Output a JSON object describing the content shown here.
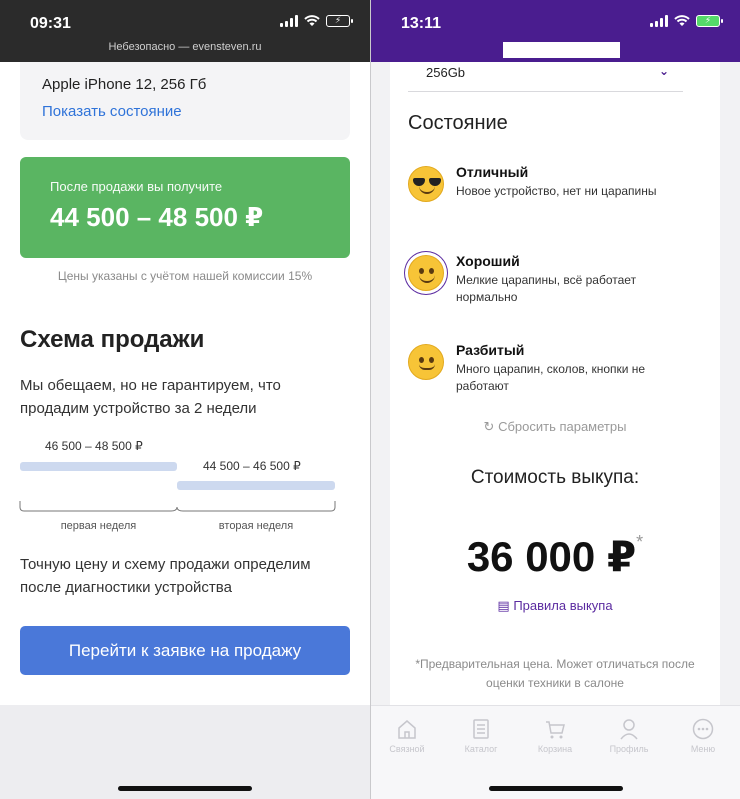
{
  "left": {
    "status": {
      "time": "09:31",
      "url": "Небезопасно — evensteven.ru"
    },
    "device": {
      "name": "Apple iPhone 12, 256 Гб",
      "show_state": "Показать состояние"
    },
    "price": {
      "caption": "После продажи вы получите",
      "range": "44 500 – 48 500 ₽"
    },
    "commission_note": "Цены указаны с учётом нашей комиссии 15%",
    "scheme": {
      "title": "Схема продажи",
      "text": "Мы обещаем, но не гарантируем, что продадим устройство за 2 недели",
      "weeks": [
        {
          "range": "46 500 – 48 500 ₽",
          "label": "первая неделя"
        },
        {
          "range": "44 500 – 46 500 ₽",
          "label": "вторая неделя"
        }
      ]
    },
    "final_text": "Точную цену и схему продажи определим после диагностики устройства",
    "go_button": "Перейти к заявке на продажу"
  },
  "right": {
    "status": {
      "time": "13:11"
    },
    "memory_select": {
      "value": "256Gb"
    },
    "condition": {
      "title": "Состояние",
      "options": [
        {
          "name": "Отличный",
          "desc": "Новое устройство, нет ни царапины",
          "icon": "sunglasses-emoji-icon",
          "selected": false
        },
        {
          "name": "Хороший",
          "desc": "Мелкие царапины, всё работает нормально",
          "icon": "smiling-emoji-icon",
          "selected": true
        },
        {
          "name": "Разбитый",
          "desc": "Много царапин, сколов, кнопки не работают",
          "icon": "slight-smile-emoji-icon",
          "selected": false
        }
      ]
    },
    "reset": "Сбросить параметры",
    "cost": {
      "title": "Стоимость выкупа:",
      "value": "36 000 ₽",
      "mark": "*"
    },
    "rules": "Правила выкупа",
    "note": "*Предварительная цена. Может отличаться после оценки техники в салоне",
    "tabs": [
      {
        "label": "Связной",
        "icon": "home-icon"
      },
      {
        "label": "Каталог",
        "icon": "catalog-icon"
      },
      {
        "label": "Корзина",
        "icon": "cart-icon"
      },
      {
        "label": "Профиль",
        "icon": "profile-icon"
      },
      {
        "label": "Меню",
        "icon": "menu-icon"
      }
    ]
  },
  "colors": {
    "price_green": "#5ab562",
    "button_blue": "#4a78d9",
    "brand_purple": "#4a1d8f"
  }
}
